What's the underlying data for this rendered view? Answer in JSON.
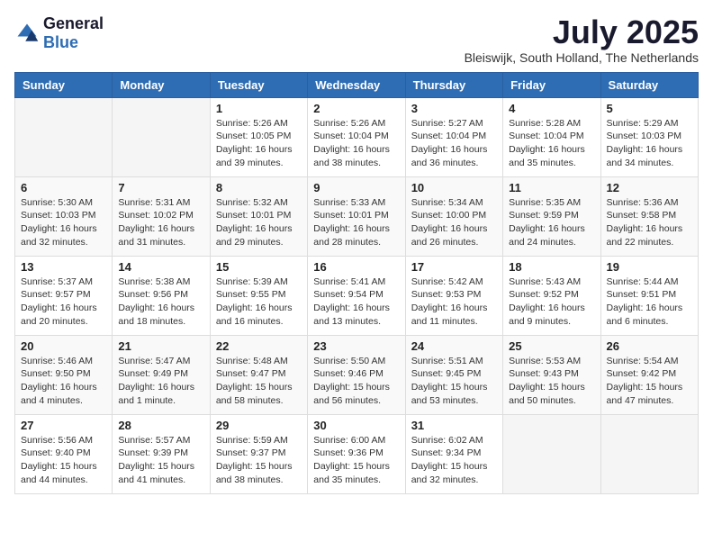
{
  "header": {
    "logo_general": "General",
    "logo_blue": "Blue",
    "title": "July 2025",
    "location": "Bleiswijk, South Holland, The Netherlands"
  },
  "weekdays": [
    "Sunday",
    "Monday",
    "Tuesday",
    "Wednesday",
    "Thursday",
    "Friday",
    "Saturday"
  ],
  "weeks": [
    [
      {
        "day": "",
        "content": ""
      },
      {
        "day": "",
        "content": ""
      },
      {
        "day": "1",
        "content": "Sunrise: 5:26 AM\nSunset: 10:05 PM\nDaylight: 16 hours and 39 minutes."
      },
      {
        "day": "2",
        "content": "Sunrise: 5:26 AM\nSunset: 10:04 PM\nDaylight: 16 hours and 38 minutes."
      },
      {
        "day": "3",
        "content": "Sunrise: 5:27 AM\nSunset: 10:04 PM\nDaylight: 16 hours and 36 minutes."
      },
      {
        "day": "4",
        "content": "Sunrise: 5:28 AM\nSunset: 10:04 PM\nDaylight: 16 hours and 35 minutes."
      },
      {
        "day": "5",
        "content": "Sunrise: 5:29 AM\nSunset: 10:03 PM\nDaylight: 16 hours and 34 minutes."
      }
    ],
    [
      {
        "day": "6",
        "content": "Sunrise: 5:30 AM\nSunset: 10:03 PM\nDaylight: 16 hours and 32 minutes."
      },
      {
        "day": "7",
        "content": "Sunrise: 5:31 AM\nSunset: 10:02 PM\nDaylight: 16 hours and 31 minutes."
      },
      {
        "day": "8",
        "content": "Sunrise: 5:32 AM\nSunset: 10:01 PM\nDaylight: 16 hours and 29 minutes."
      },
      {
        "day": "9",
        "content": "Sunrise: 5:33 AM\nSunset: 10:01 PM\nDaylight: 16 hours and 28 minutes."
      },
      {
        "day": "10",
        "content": "Sunrise: 5:34 AM\nSunset: 10:00 PM\nDaylight: 16 hours and 26 minutes."
      },
      {
        "day": "11",
        "content": "Sunrise: 5:35 AM\nSunset: 9:59 PM\nDaylight: 16 hours and 24 minutes."
      },
      {
        "day": "12",
        "content": "Sunrise: 5:36 AM\nSunset: 9:58 PM\nDaylight: 16 hours and 22 minutes."
      }
    ],
    [
      {
        "day": "13",
        "content": "Sunrise: 5:37 AM\nSunset: 9:57 PM\nDaylight: 16 hours and 20 minutes."
      },
      {
        "day": "14",
        "content": "Sunrise: 5:38 AM\nSunset: 9:56 PM\nDaylight: 16 hours and 18 minutes."
      },
      {
        "day": "15",
        "content": "Sunrise: 5:39 AM\nSunset: 9:55 PM\nDaylight: 16 hours and 16 minutes."
      },
      {
        "day": "16",
        "content": "Sunrise: 5:41 AM\nSunset: 9:54 PM\nDaylight: 16 hours and 13 minutes."
      },
      {
        "day": "17",
        "content": "Sunrise: 5:42 AM\nSunset: 9:53 PM\nDaylight: 16 hours and 11 minutes."
      },
      {
        "day": "18",
        "content": "Sunrise: 5:43 AM\nSunset: 9:52 PM\nDaylight: 16 hours and 9 minutes."
      },
      {
        "day": "19",
        "content": "Sunrise: 5:44 AM\nSunset: 9:51 PM\nDaylight: 16 hours and 6 minutes."
      }
    ],
    [
      {
        "day": "20",
        "content": "Sunrise: 5:46 AM\nSunset: 9:50 PM\nDaylight: 16 hours and 4 minutes."
      },
      {
        "day": "21",
        "content": "Sunrise: 5:47 AM\nSunset: 9:49 PM\nDaylight: 16 hours and 1 minute."
      },
      {
        "day": "22",
        "content": "Sunrise: 5:48 AM\nSunset: 9:47 PM\nDaylight: 15 hours and 58 minutes."
      },
      {
        "day": "23",
        "content": "Sunrise: 5:50 AM\nSunset: 9:46 PM\nDaylight: 15 hours and 56 minutes."
      },
      {
        "day": "24",
        "content": "Sunrise: 5:51 AM\nSunset: 9:45 PM\nDaylight: 15 hours and 53 minutes."
      },
      {
        "day": "25",
        "content": "Sunrise: 5:53 AM\nSunset: 9:43 PM\nDaylight: 15 hours and 50 minutes."
      },
      {
        "day": "26",
        "content": "Sunrise: 5:54 AM\nSunset: 9:42 PM\nDaylight: 15 hours and 47 minutes."
      }
    ],
    [
      {
        "day": "27",
        "content": "Sunrise: 5:56 AM\nSunset: 9:40 PM\nDaylight: 15 hours and 44 minutes."
      },
      {
        "day": "28",
        "content": "Sunrise: 5:57 AM\nSunset: 9:39 PM\nDaylight: 15 hours and 41 minutes."
      },
      {
        "day": "29",
        "content": "Sunrise: 5:59 AM\nSunset: 9:37 PM\nDaylight: 15 hours and 38 minutes."
      },
      {
        "day": "30",
        "content": "Sunrise: 6:00 AM\nSunset: 9:36 PM\nDaylight: 15 hours and 35 minutes."
      },
      {
        "day": "31",
        "content": "Sunrise: 6:02 AM\nSunset: 9:34 PM\nDaylight: 15 hours and 32 minutes."
      },
      {
        "day": "",
        "content": ""
      },
      {
        "day": "",
        "content": ""
      }
    ]
  ]
}
